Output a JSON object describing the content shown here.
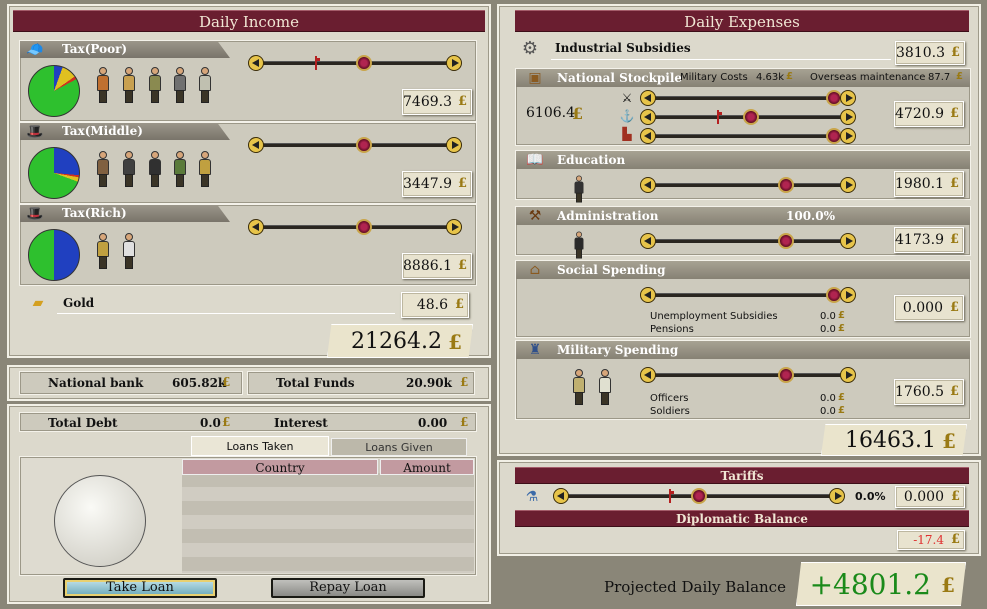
{
  "income": {
    "title": "Daily Income",
    "poor": {
      "label": "Tax(Poor)",
      "value": "7469.3"
    },
    "middle": {
      "label": "Tax(Middle)",
      "value": "3447.9"
    },
    "rich": {
      "label": "Tax(Rich)",
      "value": "8886.1"
    },
    "gold": {
      "label": "Gold",
      "value": "48.6"
    },
    "total": "21264.2"
  },
  "bank": {
    "national_bank_label": "National bank",
    "national_bank_value": "605.82k",
    "total_funds_label": "Total Funds",
    "total_funds_value": "20.90k"
  },
  "debt": {
    "total_debt_label": "Total Debt",
    "total_debt_value": "0.0",
    "interest_label": "Interest",
    "interest_value": "0.00"
  },
  "loans": {
    "tab_taken": "Loans Taken",
    "tab_given": "Loans Given",
    "col_country": "Country",
    "col_amount": "Amount",
    "take_loan": "Take Loan",
    "repay_loan": "Repay Loan"
  },
  "expenses": {
    "title": "Daily Expenses",
    "industrial": {
      "label": "Industrial Subsidies",
      "value": "3810.3"
    },
    "stockpile": {
      "label": "National Stockpile",
      "military_costs_label": "Military Costs",
      "military_costs_value": "4.63k",
      "overseas_label": "Overseas maintenance",
      "overseas_value": "87.7",
      "left_value": "6106.4",
      "value": "4720.9"
    },
    "education": {
      "label": "Education",
      "value": "1980.1"
    },
    "administration": {
      "label": "Administration",
      "efficiency": "100.0%",
      "value": "4173.9"
    },
    "social": {
      "label": "Social Spending",
      "unemployment_label": "Unemployment Subsidies",
      "unemployment_value": "0.0",
      "pensions_label": "Pensions",
      "pensions_value": "0.0",
      "value": "0.000"
    },
    "military": {
      "label": "Military Spending",
      "officers_label": "Officers",
      "officers_value": "0.0",
      "soldiers_label": "Soldiers",
      "soldiers_value": "0.0",
      "value": "1760.5"
    },
    "total": "16463.1"
  },
  "tariffs": {
    "title": "Tariffs",
    "percent": "0.0%",
    "value": "0.000",
    "diplomatic_label": "Diplomatic Balance",
    "diplomatic_value": "-17.4"
  },
  "balance": {
    "label": "Projected Daily Balance",
    "value": "+4801.2"
  },
  "colors": {
    "header": "#6a1e30",
    "positive": "#1a8a1a",
    "negative": "#e03030",
    "pie_green": "#2ec02e",
    "pie_blue": "#2040c0"
  },
  "slider_levels": {
    "poor": 0.55,
    "middle": 0.55,
    "rich": 0.55,
    "stockpile_1": 1.0,
    "stockpile_2": 0.52,
    "stockpile_3": 1.0,
    "education": 0.72,
    "administration": 0.72,
    "social": 1.0,
    "military": 0.72,
    "tariffs": 0.5
  }
}
